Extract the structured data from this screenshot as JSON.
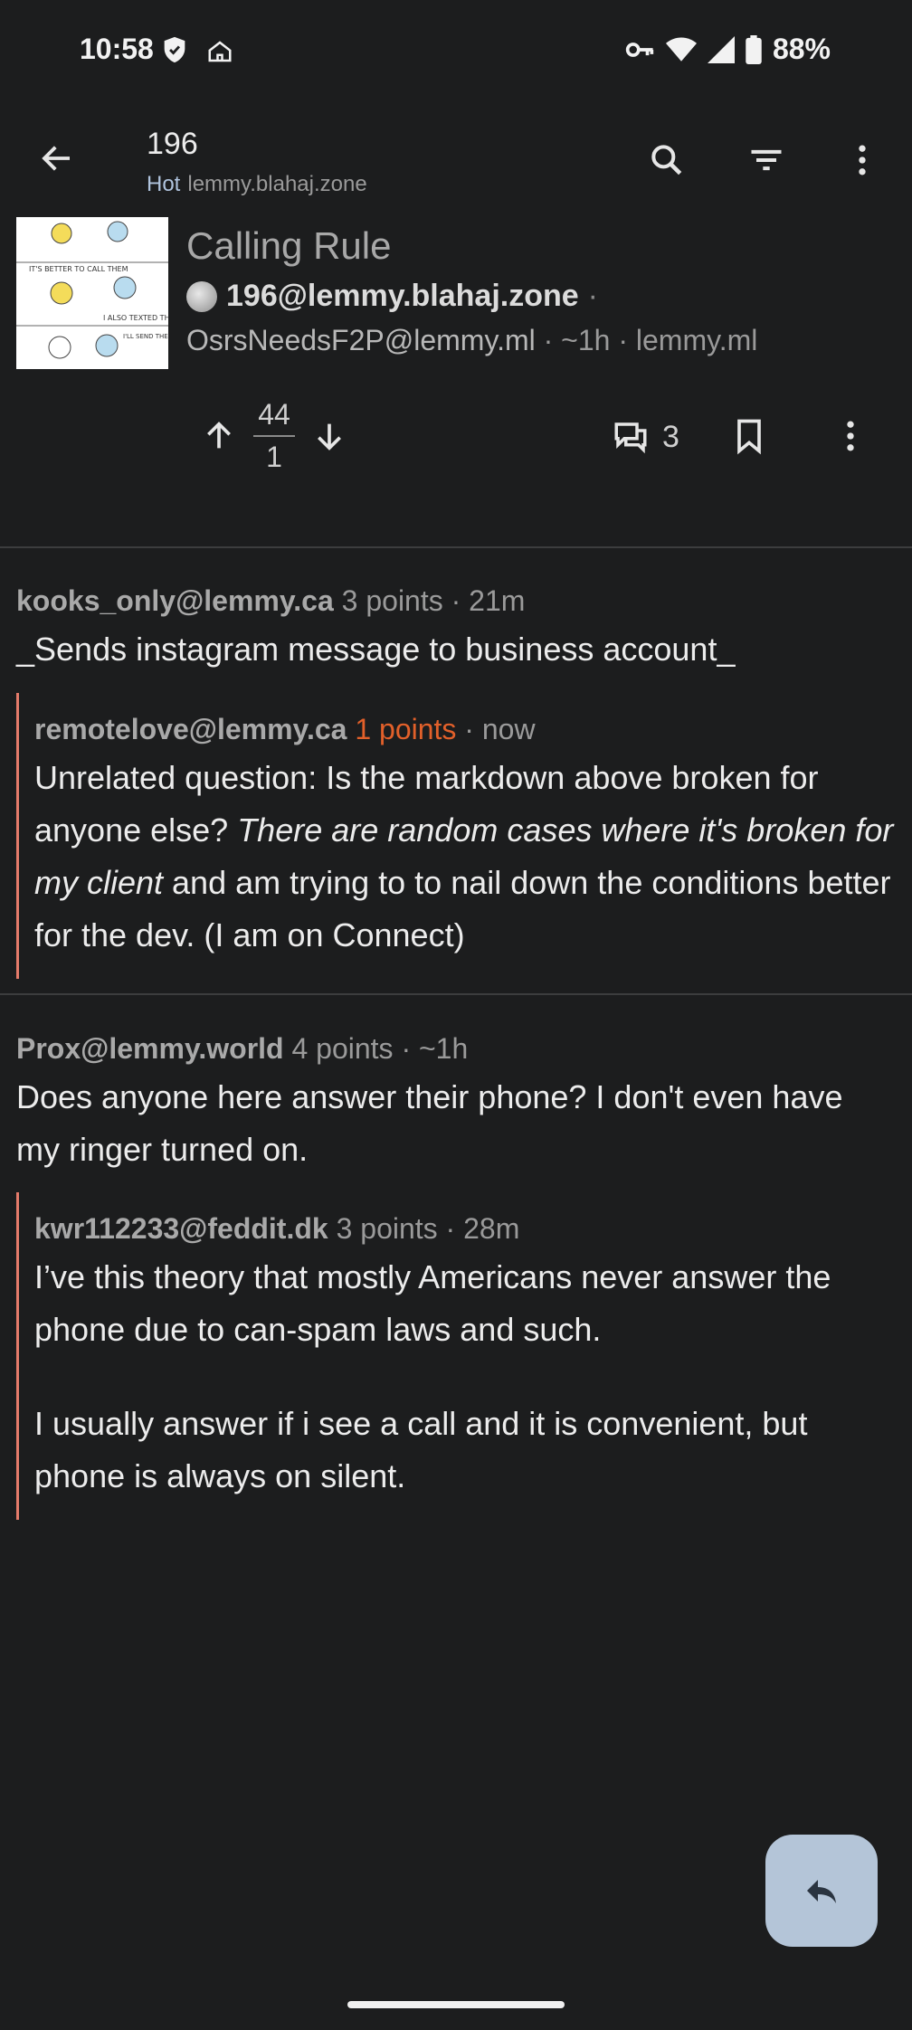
{
  "status_bar": {
    "time": "10:58",
    "battery": "88%"
  },
  "app_bar": {
    "title": "196",
    "sort": "Hot",
    "instance": "lemmy.blahaj.zone"
  },
  "post": {
    "title": "Calling Rule",
    "community": "196@lemmy.blahaj.zone",
    "community_sep": "·",
    "author": "OsrsNeedsF2P@lemmy.ml",
    "meta_suffix": "· ~1h · lemmy.ml",
    "upvotes": "44",
    "downvotes": "1",
    "comment_count": "3",
    "thumbnail_texts": [
      "IT'S BETTER TO CALL THEM",
      "I ALSO TEXTED THEM",
      "I'LL SEND THEM MOST"
    ]
  },
  "comments": [
    {
      "user": "kooks_only@lemmy.ca",
      "points": "3 points",
      "time": "· 21m",
      "body": "_Sends instagram message to business account_"
    },
    {
      "user": "remotelove@lemmy.ca",
      "points": "1 points",
      "time": "· now",
      "body_start": "Unrelated question: Is the markdown above broken for anyone else? ",
      "body_italic": "There are random cases where it's broken for my client",
      "body_end": " and am trying to to nail down the conditions better for the dev.  (I am on Connect)"
    },
    {
      "user": "Prox@lemmy.world",
      "points": "4 points",
      "time": "· ~1h",
      "body": "Does anyone here answer their phone? I don't even have my ringer turned on."
    },
    {
      "user": "kwr112233@feddit.dk",
      "points": "3 points",
      "time": "· 28m",
      "body_p1": "I’ve this theory that mostly Americans never answer the phone due to can-spam laws and such.",
      "body_p2": "I usually answer if i see a call and it is convenient, but phone is always on silent."
    }
  ],
  "colors": {
    "background": "#1c1d1e",
    "accent_orange": "#e2602a",
    "reply_bar": "#e47b6a",
    "fab": "#b4c5d8"
  }
}
